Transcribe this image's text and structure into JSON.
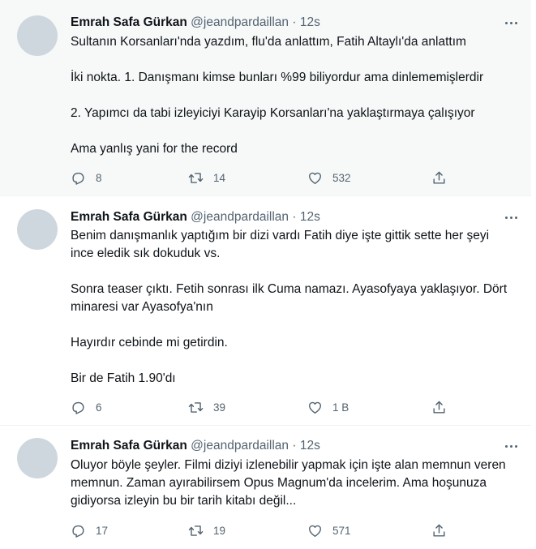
{
  "tweets": [
    {
      "name": "Emrah Safa Gürkan",
      "handle": "@jeandpardaillan",
      "dot": "·",
      "time": "12s",
      "paragraphs": [
        "Sultanın Korsanları'nda yazdım, flu'da anlattım, Fatih Altaylı'da anlattım",
        "İki nokta. 1. Danışmanı kimse bunları %99 biliyordur ama dinlememişlerdir",
        "2. Yapımcı da tabi izleyiciyi Karayip Korsanları'na yaklaştırmaya çalışıyor",
        "Ama yanlış yani for the record"
      ],
      "replies": "8",
      "retweets": "14",
      "likes": "532"
    },
    {
      "name": "Emrah Safa Gürkan",
      "handle": "@jeandpardaillan",
      "dot": "·",
      "time": "12s",
      "paragraphs": [
        "Benim danışmanlık yaptığım bir dizi vardı Fatih diye işte gittik sette her şeyi ince eledik sık dokuduk vs.",
        "Sonra teaser çıktı. Fetih sonrası ilk Cuma namazı. Ayasofyaya yaklaşıyor. Dört minaresi var Ayasofya'nın",
        "Hayırdır cebinde mi getirdin.",
        "Bir de Fatih 1.90'dı"
      ],
      "replies": "6",
      "retweets": "39",
      "likes": "1 B"
    },
    {
      "name": "Emrah Safa Gürkan",
      "handle": "@jeandpardaillan",
      "dot": "·",
      "time": "12s",
      "paragraphs": [
        "Oluyor böyle şeyler. Filmi diziyi izlenebilir yapmak için işte alan memnun veren memnun. Zaman ayırabilirsem Opus Magnum'da incelerim. Ama hoşunuza gidiyorsa izleyin bu bir tarih kitabı değil..."
      ],
      "replies": "17",
      "retweets": "19",
      "likes": "571"
    }
  ],
  "icons": {
    "reply": "reply-icon",
    "retweet": "retweet-icon",
    "like": "heart-icon",
    "share": "share-icon",
    "more": "more-icon"
  },
  "colors": {
    "text": "#0f1419",
    "secondary": "#536471",
    "highlight_bg": "#f7f9f9",
    "avatar": "#cfd7de"
  }
}
